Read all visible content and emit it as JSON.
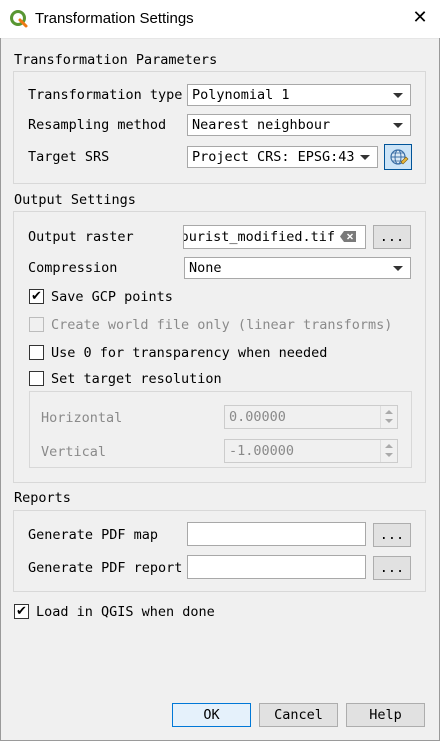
{
  "window": {
    "title": "Transformation Settings"
  },
  "transformation_parameters": {
    "title": "Transformation Parameters",
    "type_label": "Transformation type",
    "type_value": "Polynomial 1",
    "resampling_label": "Resampling method",
    "resampling_value": "Nearest neighbour",
    "srs_label": "Target SRS",
    "srs_value": "Project CRS: EPSG:43"
  },
  "output_settings": {
    "title": "Output Settings",
    "raster_label": "Output raster",
    "raster_value": "ourist_modified.tif",
    "browse_label": "...",
    "compression_label": "Compression",
    "compression_value": "None",
    "save_gcp_label": "Save GCP points",
    "save_gcp_checked": true,
    "world_file_label": "Create world file only (linear transforms)",
    "world_file_checked": false,
    "transparency_label": "Use 0 for transparency when needed",
    "transparency_checked": false,
    "target_res_label": "Set target resolution",
    "target_res_checked": false,
    "horizontal_label": "Horizontal",
    "horizontal_value": "0.00000",
    "vertical_label": "Vertical",
    "vertical_value": "-1.00000"
  },
  "reports": {
    "title": "Reports",
    "pdf_map_label": "Generate PDF map",
    "pdf_map_value": "",
    "pdf_report_label": "Generate PDF report",
    "pdf_report_value": "",
    "browse_label": "..."
  },
  "load_in_qgis": {
    "label": "Load in QGIS when done",
    "checked": true
  },
  "buttons": {
    "ok": "OK",
    "cancel": "Cancel",
    "help": "Help"
  },
  "checkmark": "✔",
  "colors": {
    "accent": "#0078d7",
    "qgis_green": "#589632",
    "qgis_yellow": "#ee7913"
  }
}
